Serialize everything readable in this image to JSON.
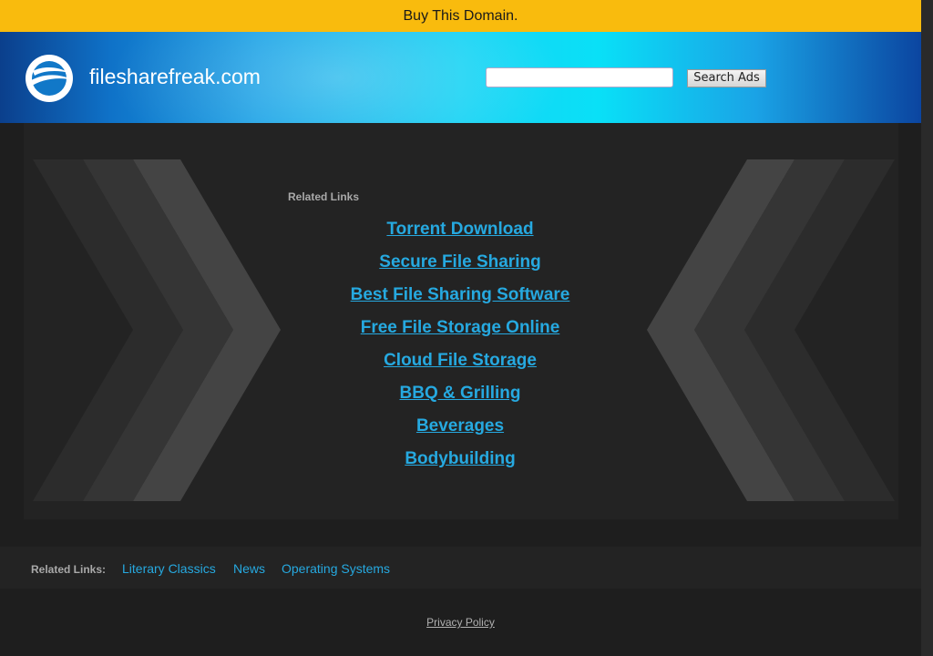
{
  "banner": {
    "text": "Buy This Domain."
  },
  "header": {
    "site_name": "filesharefreak.com",
    "logo_icon": "globe-swoosh-icon",
    "search": {
      "placeholder": "",
      "value": "",
      "button_label": "Search Ads"
    }
  },
  "main": {
    "related_heading": "Related Links",
    "links": [
      "Torrent Download",
      "Secure File Sharing",
      "Best File Sharing Software",
      "Free File Storage Online",
      "Cloud File Storage",
      "BBQ & Grilling",
      "Beverages",
      "Bodybuilding"
    ]
  },
  "footer": {
    "label": "Related Links:",
    "links": [
      "Literary Classics",
      "News",
      "Operating Systems"
    ],
    "privacy": "Privacy Policy"
  },
  "colors": {
    "banner": "#f9bb0d",
    "link": "#26a9e0",
    "background": "#1e1e1e"
  }
}
